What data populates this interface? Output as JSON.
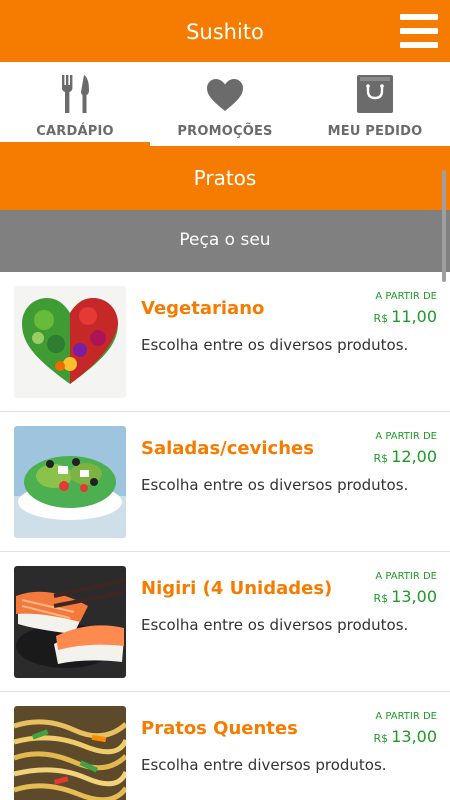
{
  "app": {
    "title": "Sushito"
  },
  "header": {
    "menu_icon": "hamburger-menu-icon"
  },
  "tabs": [
    {
      "label": "CARDÁPIO",
      "icon": "fork-knife-icon",
      "active": true
    },
    {
      "label": "PROMOÇÕES",
      "icon": "heart-icon",
      "active": false
    },
    {
      "label": "MEU PEDIDO",
      "icon": "shopping-bag-icon",
      "active": false
    }
  ],
  "section": {
    "title": "Pratos"
  },
  "subheader": {
    "text": "Peça o seu"
  },
  "colors": {
    "accent": "#f57c00",
    "price": "#1f9a27",
    "subheader": "#808080"
  },
  "items": [
    {
      "name": "Vegetariano",
      "description": "Escolha entre os diversos produtos.",
      "price_label": "A PARTIR DE",
      "currency": "R$",
      "price": "11,00",
      "image": "vegetable-heart-image"
    },
    {
      "name": "Saladas/ceviches",
      "description": "Escolha entre os diversos produtos.",
      "price_label": "A PARTIR DE",
      "currency": "R$",
      "price": "12,00",
      "image": "salad-image"
    },
    {
      "name": "Nigiri (4 Unidades)",
      "description": "Escolha entre os diversos produtos.",
      "price_label": "A PARTIR DE",
      "currency": "R$",
      "price": "13,00",
      "image": "nigiri-image"
    },
    {
      "name": "Pratos Quentes",
      "description": "Escolha entre diversos produtos.",
      "price_label": "A PARTIR DE",
      "currency": "R$",
      "price": "13,00",
      "image": "noodles-image"
    }
  ]
}
